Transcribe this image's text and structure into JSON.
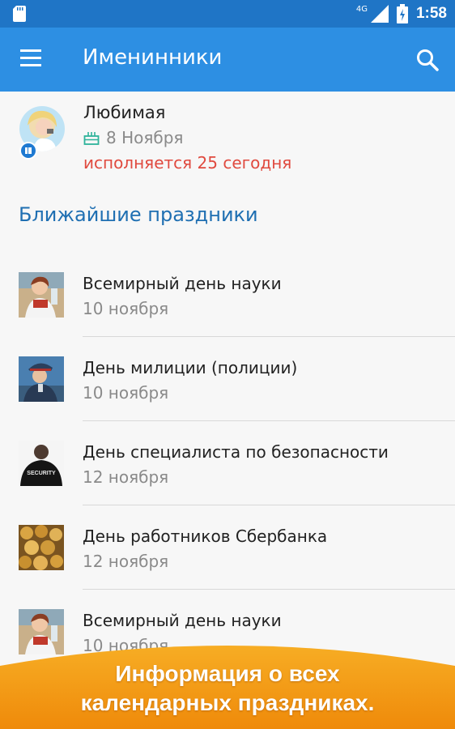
{
  "status_bar": {
    "network": "4G",
    "time": "1:58"
  },
  "app_bar": {
    "title": "Именинники",
    "menu_icon": "hamburger-menu-icon",
    "search_icon": "search-icon"
  },
  "birthday": {
    "name": "Любимая",
    "date": "8 Ноября",
    "age_text": "исполняется 25 сегодня"
  },
  "section": {
    "title": "Ближайшие праздники"
  },
  "holidays": [
    {
      "title": "Всемирный день науки",
      "date": "10 ноября",
      "thumb": "scientist"
    },
    {
      "title": "День милиции (полиции)",
      "date": "10 ноября",
      "thumb": "police"
    },
    {
      "title": "День специалиста по безопасности",
      "date": "12 ноября",
      "thumb": "security",
      "thumb_text": "SECURITY"
    },
    {
      "title": "День работников Сбербанка",
      "date": "12 ноября",
      "thumb": "coins"
    },
    {
      "title": "Всемирный день науки",
      "date": "10 ноября",
      "thumb": "scientist"
    }
  ],
  "promo": {
    "line1": "Информация о всех",
    "line2": "календарных праздниках."
  },
  "colors": {
    "status_bar": "#1f75c6",
    "app_bar": "#2d8fe3",
    "accent_title": "#1f6fb2",
    "age_red": "#e04a3f",
    "promo_orange": "#f39a10"
  }
}
